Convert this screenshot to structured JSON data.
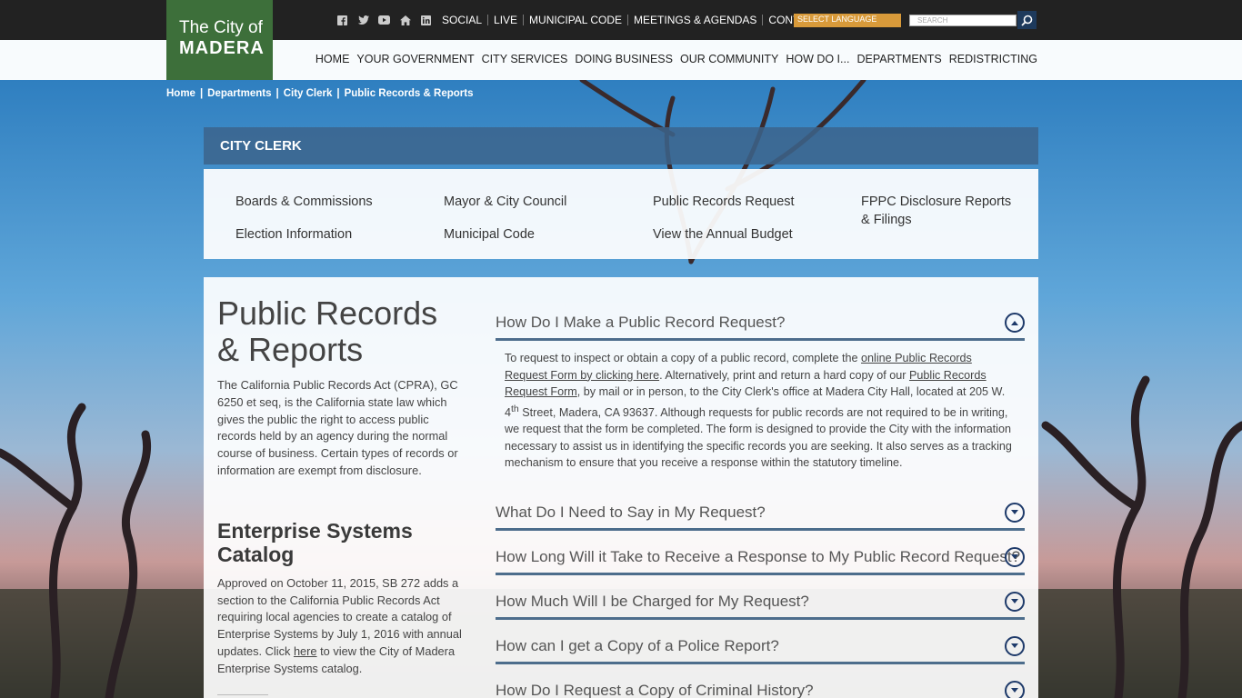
{
  "logo": {
    "line1": "The City of",
    "line2": "MADERA"
  },
  "utility": {
    "icons": [
      "facebook-icon",
      "twitter-icon",
      "youtube-icon",
      "home-icon",
      "linkedin-icon"
    ],
    "links": [
      "SOCIAL",
      "LIVE",
      "MUNICIPAL CODE",
      "MEETINGS & AGENDAS",
      "CONTACT"
    ],
    "language": "SELECT LANGUAGE",
    "search_placeholder": "SEARCH"
  },
  "nav": [
    "HOME",
    "YOUR GOVERNMENT",
    "CITY SERVICES",
    "DOING BUSINESS",
    "OUR COMMUNITY",
    "HOW DO I...",
    "DEPARTMENTS",
    "REDISTRICTING"
  ],
  "breadcrumb": [
    "Home",
    "Departments",
    "City Clerk",
    "Public Records & Reports"
  ],
  "clerk": {
    "title": "CITY CLERK",
    "links": [
      "Boards & Commissions",
      "Mayor & City Council",
      "Public Records Request",
      "FPPC Disclosure Reports & Filings",
      "Election Information",
      "Municipal Code",
      "View the Annual Budget"
    ]
  },
  "main": {
    "title": "Public Records & Reports",
    "intro": "The California Public Records Act (CPRA), GC 6250 et seq, is the California state law which gives the public the right to access public records held by an agency during the normal course of business. Certain types of records or information are exempt from disclosure.",
    "catalog_title": "Enterprise Systems Catalog",
    "catalog_text_1": "Approved on October 11, 2015, SB 272 adds a section to the California Public Records Act requiring local agencies to create a catalog of Enterprise Systems by July 1, 2016 with annual updates.  Click ",
    "catalog_link": "here",
    "catalog_text_2": " to view the City of Madera Enterprise Systems catalog."
  },
  "faq": {
    "q1": "How Do I Make a Public Record Request?",
    "a1_part1": "To request to inspect or obtain a copy of a public record, complete the ",
    "a1_link1": "online Public Records Request Form by clicking here",
    "a1_part2": ". Alternatively, print and return a hard copy of our ",
    "a1_link2": "Public Records Request Form",
    "a1_part3": ", by mail or in person, to the City Clerk's office at Madera City Hall, located at 205 W. 4",
    "a1_sup": "th",
    "a1_part4": " Street, Madera, CA 93637. Although requests for public records are not required to be in writing, we request that the form be completed. The form is designed to provide the City with the information necessary to assist us in identifying the specific records you are seeking. It also serves as a tracking mechanism to ensure that you receive a response within the statutory timeline.",
    "questions": [
      "What Do I Need to Say in My Request?",
      "How Long Will it Take to Receive a Response to My Public Record Request?",
      "How Much Will I be Charged for My Request?",
      "How can I get a Copy of a Police Report?",
      "How Do I Request a Copy of Criminal History?"
    ]
  }
}
